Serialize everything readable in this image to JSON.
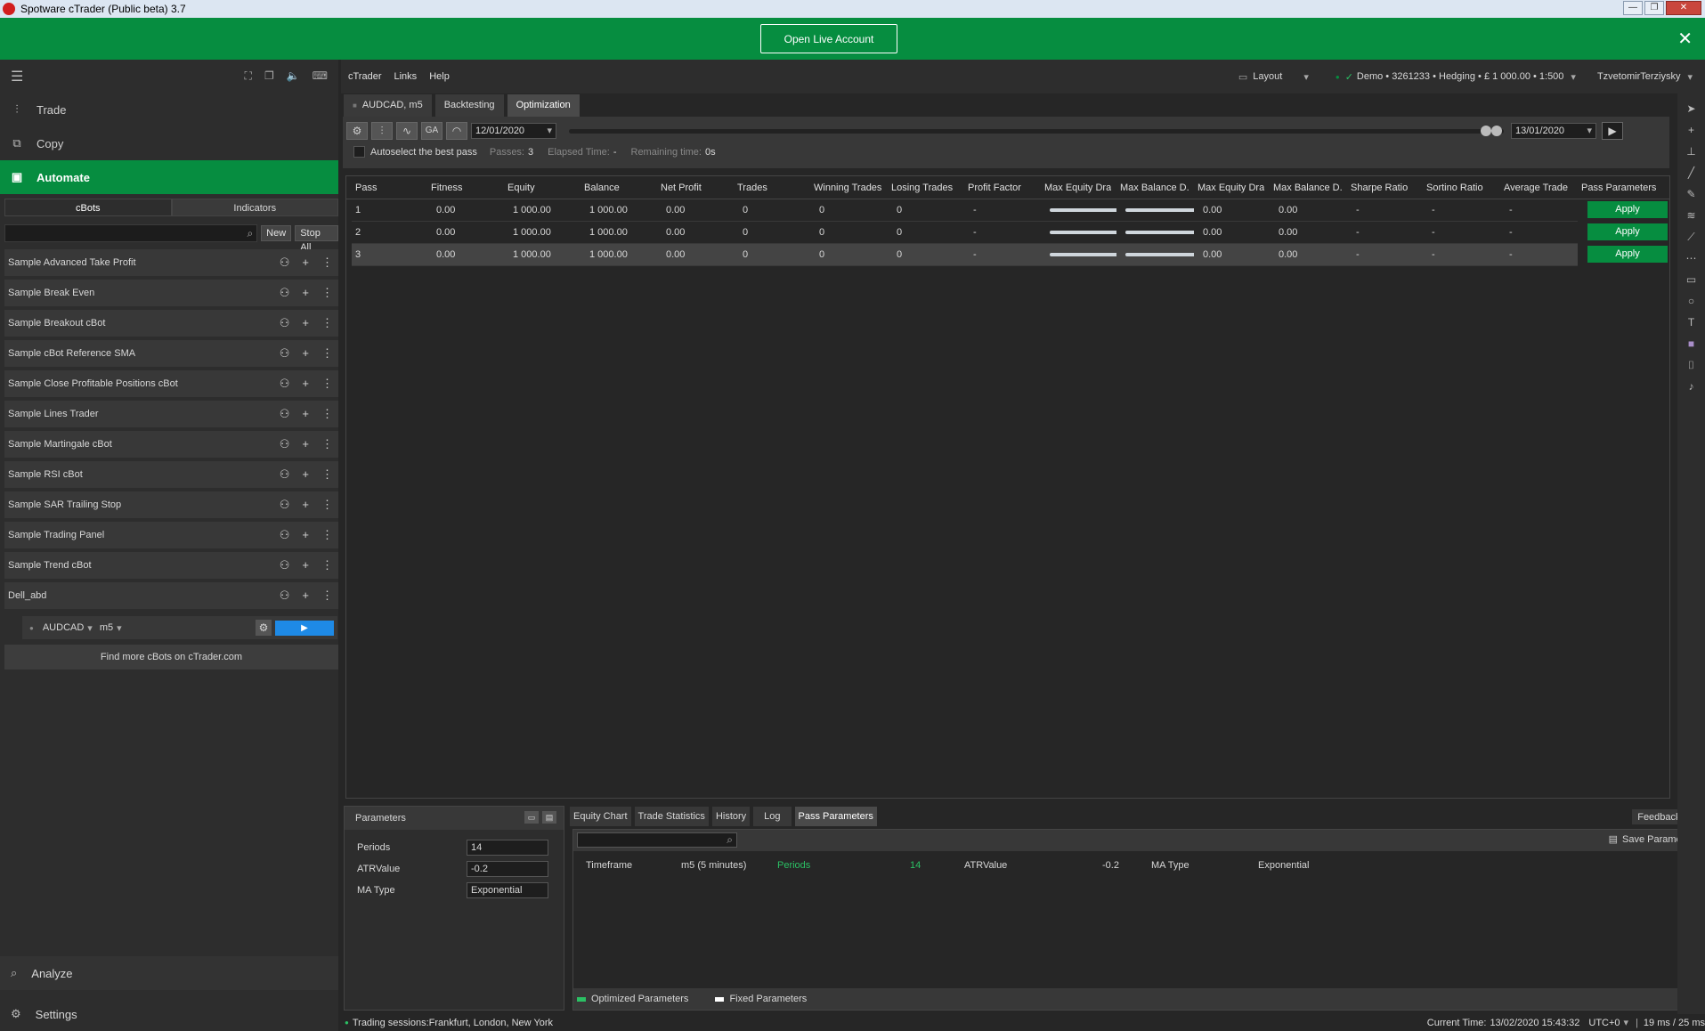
{
  "window": {
    "title": "Spotware cTrader (Public beta) 3.7"
  },
  "banner": {
    "live_button": "Open Live Account",
    "close": "✕"
  },
  "left": {
    "nav": [
      {
        "label": "Trade",
        "icon": "trade-icon"
      },
      {
        "label": "Copy",
        "icon": "copy-icon"
      },
      {
        "label": "Automate",
        "icon": "automate-icon"
      }
    ],
    "subtabs": [
      "cBots",
      "Indicators"
    ],
    "new_label": "New",
    "stopall_label": "Stop All",
    "bots": [
      "Sample Advanced Take Profit",
      "Sample Break Even",
      "Sample Breakout cBot",
      "Sample cBot Reference SMA",
      "Sample Close Profitable Positions cBot",
      "Sample Lines Trader",
      "Sample Martingale cBot",
      "Sample RSI cBot",
      "Sample SAR Trailing Stop",
      "Sample Trading Panel",
      "Sample Trend cBot",
      "Dell_abd"
    ],
    "instance": {
      "symbol": "AUDCAD",
      "timeframe": "m5"
    },
    "find_more": "Find more cBots on cTrader.com",
    "analyze": "Analyze",
    "settings": "Settings"
  },
  "menu": {
    "items": [
      "cTrader",
      "Links",
      "Help"
    ],
    "layout": "Layout",
    "account": "Demo • 3261233 • Hedging • £ 1 000.00 • 1:500",
    "user": "TzvetomirTerziysky"
  },
  "tabs": [
    "AUDCAD, m5",
    "Backtesting",
    "Optimization"
  ],
  "toolbar": {
    "start_date": "12/01/2020",
    "end_date": "13/01/2020",
    "ga_label": "GA",
    "autoselect": "Autoselect the best pass",
    "passes_label": "Passes:",
    "passes_value": "3",
    "elapsed_label": "Elapsed Time:",
    "elapsed_value": "-",
    "remaining_label": "Remaining time:",
    "remaining_value": "0s"
  },
  "results": {
    "columns": [
      "Pass",
      "Fitness",
      "Equity",
      "Balance",
      "Net Profit",
      "Trades",
      "Winning Trades",
      "Losing Trades",
      "Profit Factor",
      "Max Equity Dra...",
      "Max Balance D...",
      "Max Equity Dra...",
      "Max Balance D...",
      "Sharpe Ratio",
      "Sortino Ratio",
      "Average Trade",
      "Pass Parameters"
    ],
    "rows": [
      [
        "1",
        "0.00",
        "1 000.00",
        "1 000.00",
        "0.00",
        "0",
        "0",
        "0",
        "-",
        "",
        "",
        "0.00",
        "0.00",
        "-",
        "-",
        "-"
      ],
      [
        "2",
        "0.00",
        "1 000.00",
        "1 000.00",
        "0.00",
        "0",
        "0",
        "0",
        "-",
        "",
        "",
        "0.00",
        "0.00",
        "-",
        "-",
        "-"
      ],
      [
        "3",
        "0.00",
        "1 000.00",
        "1 000.00",
        "0.00",
        "0",
        "0",
        "0",
        "-",
        "",
        "",
        "0.00",
        "0.00",
        "-",
        "-",
        "-"
      ]
    ],
    "apply_label": "Apply"
  },
  "params": {
    "title": "Parameters",
    "rows": [
      {
        "label": "Periods",
        "value": "14"
      },
      {
        "label": "ATRValue",
        "value": "-0.2"
      },
      {
        "label": "MA Type",
        "value": "Exponential"
      }
    ]
  },
  "detail": {
    "tabs": [
      "Equity Chart",
      "Trade Statistics",
      "History",
      "Log",
      "Pass Parameters"
    ],
    "feedback": "Feedback",
    "save": "Save Parameters",
    "timeframe_label": "Timeframe",
    "timeframe_value": "m5 (5 minutes)",
    "periods_label": "Periods",
    "periods_value": "14",
    "atr_label": "ATRValue",
    "atr_value": "-0.2",
    "ma_label": "MA Type",
    "ma_value": "Exponential",
    "legend_opt": "Optimized Parameters",
    "legend_fixed": "Fixed Parameters"
  },
  "status": {
    "sessions": "Trading sessions:Frankfurt, London, New York",
    "current_time_label": "Current Time:",
    "current_time": "13/02/2020 15:43:32",
    "tz": "UTC+0",
    "latency": "19 ms / 25 ms"
  },
  "colors": {
    "accent_green": "#068d40",
    "play_blue": "#1e8ae6"
  }
}
